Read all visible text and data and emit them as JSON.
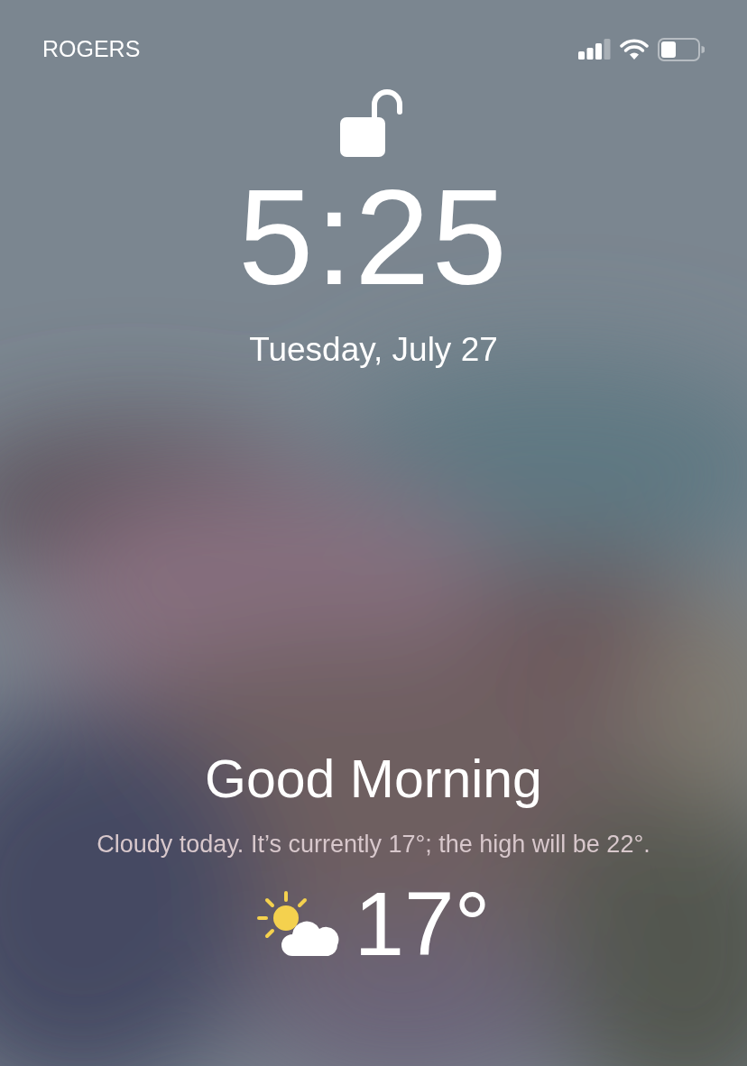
{
  "status_bar": {
    "carrier": "ROGERS"
  },
  "lock": {
    "locked": false
  },
  "clock": {
    "time": "5:25",
    "date": "Tuesday, July 27"
  },
  "greeting": {
    "title": "Good Morning",
    "summary": "Cloudy today. It’s currently 17°; the high will be 22°."
  },
  "weather": {
    "temperature": "17°"
  }
}
